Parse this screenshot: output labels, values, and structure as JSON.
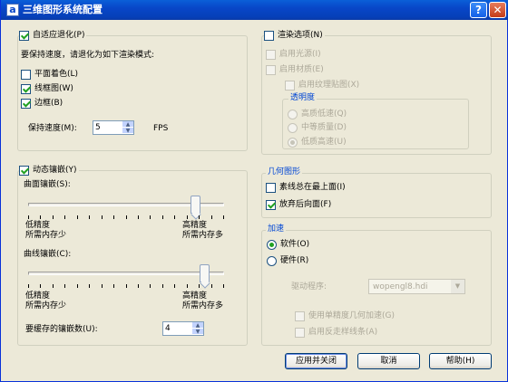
{
  "window": {
    "title": "三维图形系统配置",
    "help_button": "?",
    "close_button": "✕",
    "app_icon": "a"
  },
  "adaptive": {
    "checkbox_label": "自适应退化(P)",
    "instruction": "要保持速度，请退化为如下渲染模式:",
    "flat": "平面着色(L)",
    "wireframe": "线框图(W)",
    "bbox": "边框(B)",
    "speed_label": "保持速度(M):",
    "speed_value": "5",
    "speed_unit": "FPS"
  },
  "render": {
    "checkbox_label": "渲染选项(N)",
    "lights": "启用光源(I)",
    "materials": "启用材质(E)",
    "texture": "启用纹理贴图(X)",
    "transparency_title": "透明度",
    "high_quality": "高质低速(Q)",
    "medium_quality": "中等质量(D)",
    "low_quality": "低质高速(U)"
  },
  "tess": {
    "checkbox_label": "动态镶嵌(Y)",
    "surface_label": "曲面镶嵌(S):",
    "surface_level": 0.85,
    "surface_low": "低精度",
    "surface_low_sub": "所需内存少",
    "surface_high": "高精度",
    "surface_high_sub": "所需内存多",
    "curve_label": "曲线镶嵌(C):",
    "curve_level": 0.9,
    "curve_low": "低精度",
    "curve_low_sub": "所需内存少",
    "curve_high": "高精度",
    "curve_high_sub": "所需内存多",
    "cache_label": "要缓存的镶嵌数(U):",
    "cache_value": "4"
  },
  "geometry": {
    "title": "几何图形",
    "isolines_on_top": "素线总在最上面(I)",
    "discard_backfaces": "放弃后向面(F)"
  },
  "acceleration": {
    "title": "加速",
    "software": "软件(O)",
    "hardware": "硬件(R)",
    "driver_label": "驱动程序:",
    "driver_value": "wopengl8.hdi",
    "single_precision": "使用单精度几何加速(G)",
    "antialias": "启用反走样线条(A)"
  },
  "buttons": {
    "apply_close": "应用并关闭",
    "cancel": "取消",
    "help": "帮助(H)"
  }
}
